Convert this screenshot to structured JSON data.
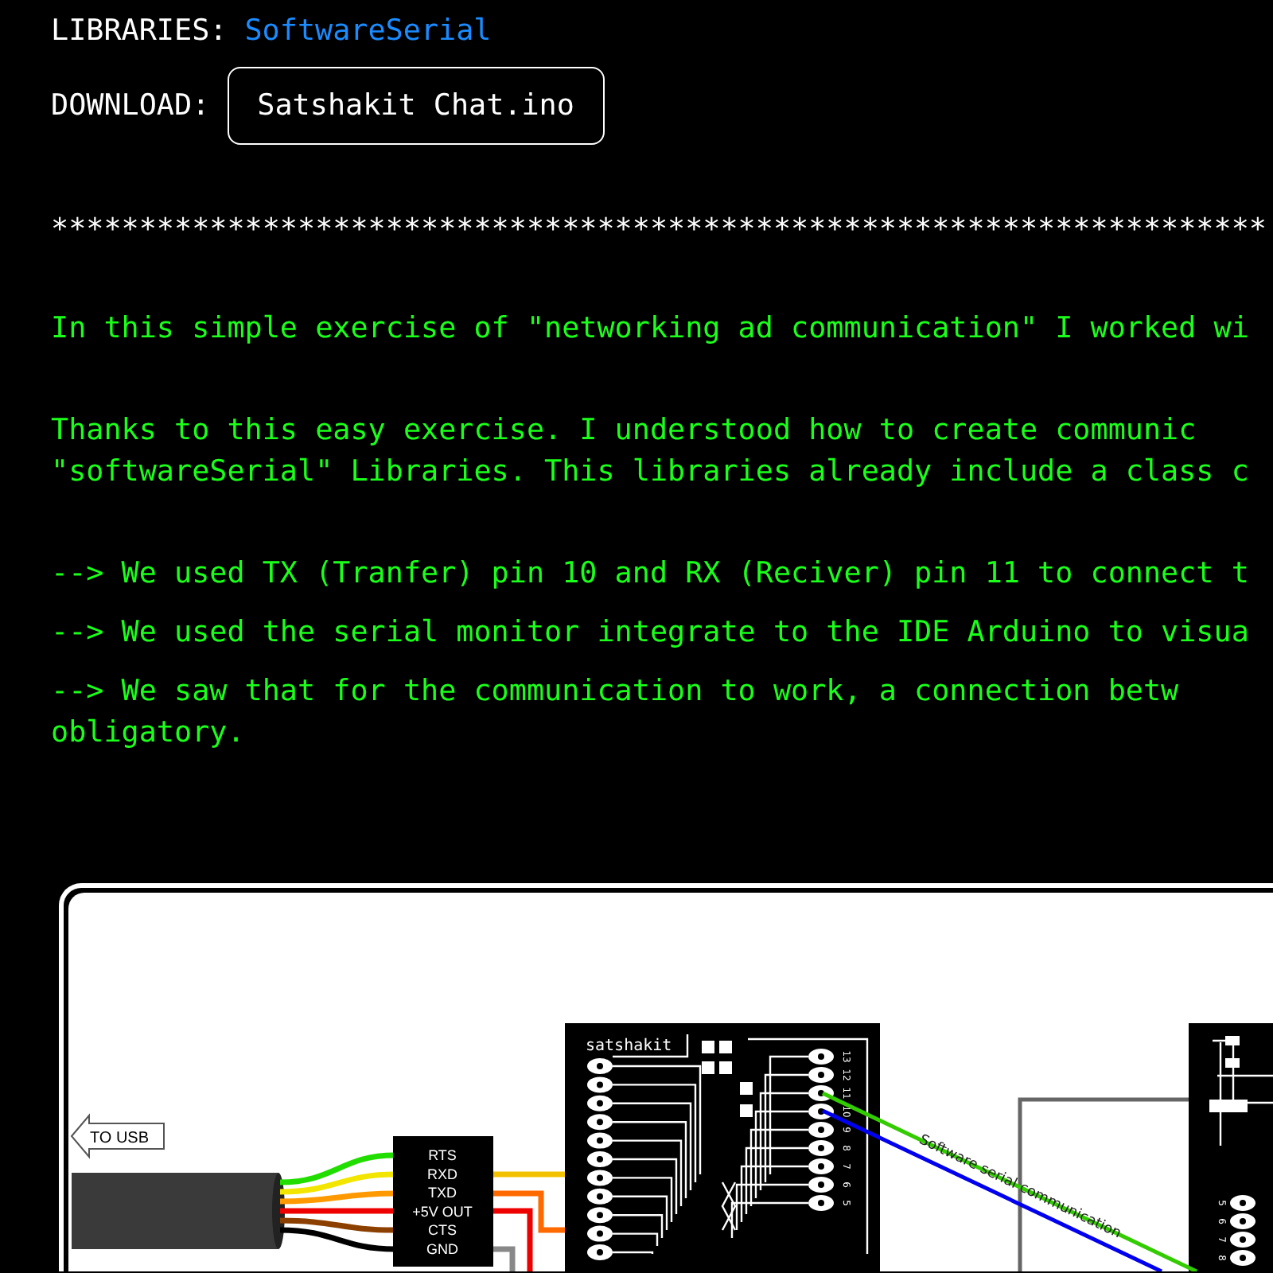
{
  "libraries": {
    "label": "LIBRARIES:",
    "link": "SoftwareSerial"
  },
  "download": {
    "label": "DOWNLOAD:",
    "button": "Satshakit Chat.ino"
  },
  "separator": "*********************************************************************",
  "paragraphs": [
    {
      "kind": "text",
      "lines": [
        "In this simple exercise of \"networking ad communication\" I worked wi"
      ]
    },
    {
      "kind": "text",
      "lines": [
        "Thanks to this easy exercise. I understood how to create communic",
        "\"softwareSerial\" Libraries. This libraries already include a class c"
      ]
    },
    {
      "kind": "bullet",
      "lines": [
        "--> We used TX (Tranfer) pin 10 and RX (Reciver) pin 11 to connect t"
      ]
    },
    {
      "kind": "bullet",
      "lines": [
        "--> We used the serial monitor integrate to the IDE Arduino to visua"
      ]
    },
    {
      "kind": "bullet",
      "lines": [
        "--> We saw that for the communication to work, a connection betw",
        "obligatory."
      ]
    }
  ],
  "diagram": {
    "usb_label": "TO USB",
    "adapter_pins": [
      "RTS",
      "RXD",
      "TXD",
      "+5V OUT",
      "CTS",
      "GND"
    ],
    "board_label": "satshakit",
    "board_pins": [
      "13",
      "12",
      "11",
      "10",
      "9",
      "8",
      "7",
      "6",
      "5"
    ],
    "right_board_pins": [
      "5",
      "6",
      "7",
      "8"
    ],
    "link_label": "Software serial communication"
  }
}
